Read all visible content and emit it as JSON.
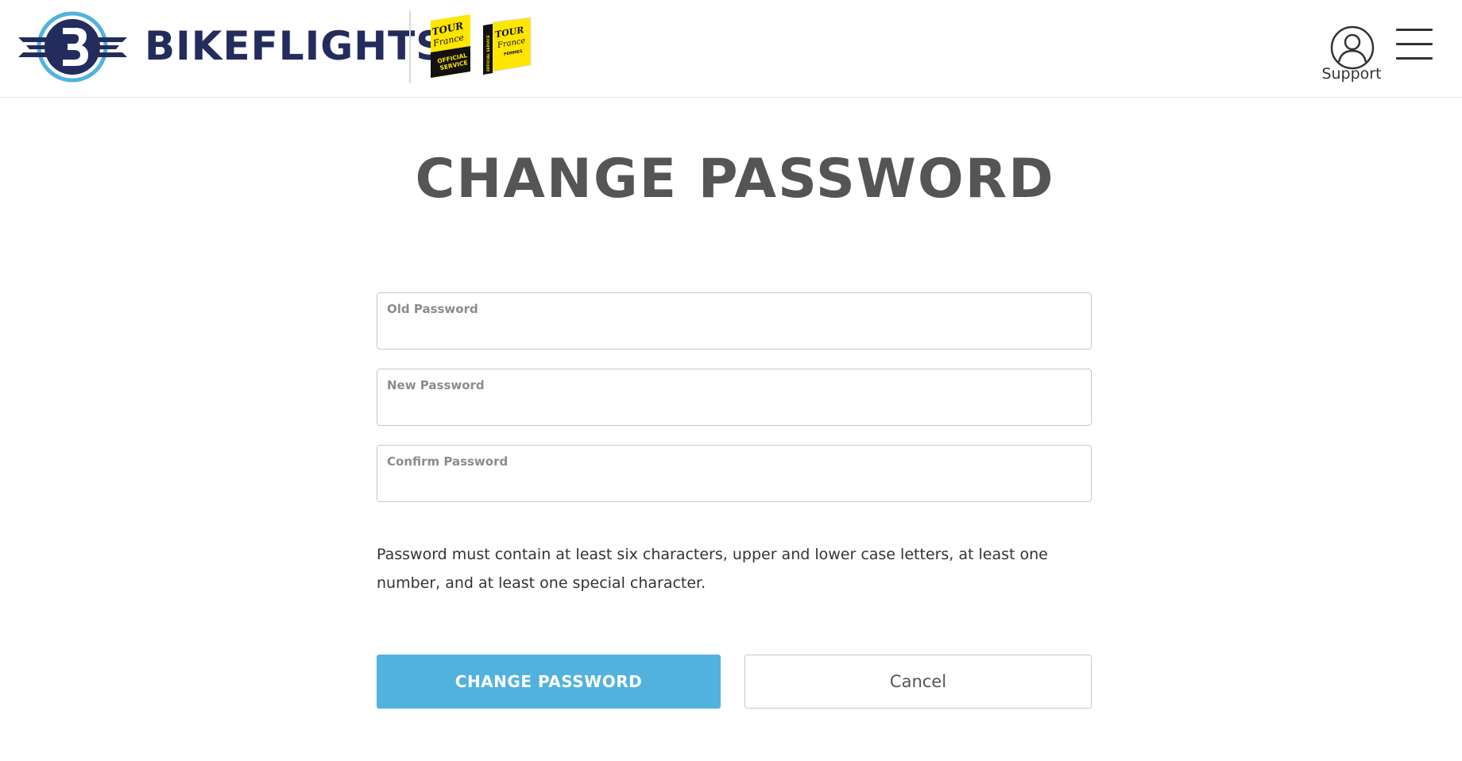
{
  "header": {
    "brand_name": "BIKEFLIGHTS",
    "badges": [
      {
        "lines": [
          "TOUR",
          "France",
          "OFFICIAL",
          "SERVICE"
        ]
      },
      {
        "lines": [
          "OFFICIAL SERVICE",
          "TOUR",
          "France",
          "FEMMES"
        ]
      }
    ],
    "support_label": "Support",
    "colors": {
      "brand_navy": "#232c5d",
      "brand_blue": "#52b2de",
      "badge_yellow": "#ffe600"
    }
  },
  "main": {
    "title": "CHANGE PASSWORD",
    "fields": [
      {
        "label": "Old Password",
        "value": ""
      },
      {
        "label": "New Password",
        "value": ""
      },
      {
        "label": "Confirm Password",
        "value": ""
      }
    ],
    "hint": "Password must contain at least six characters, upper and lower case letters, at least one number, and at least one special character.",
    "submit_label": "CHANGE PASSWORD",
    "cancel_label": "Cancel"
  }
}
